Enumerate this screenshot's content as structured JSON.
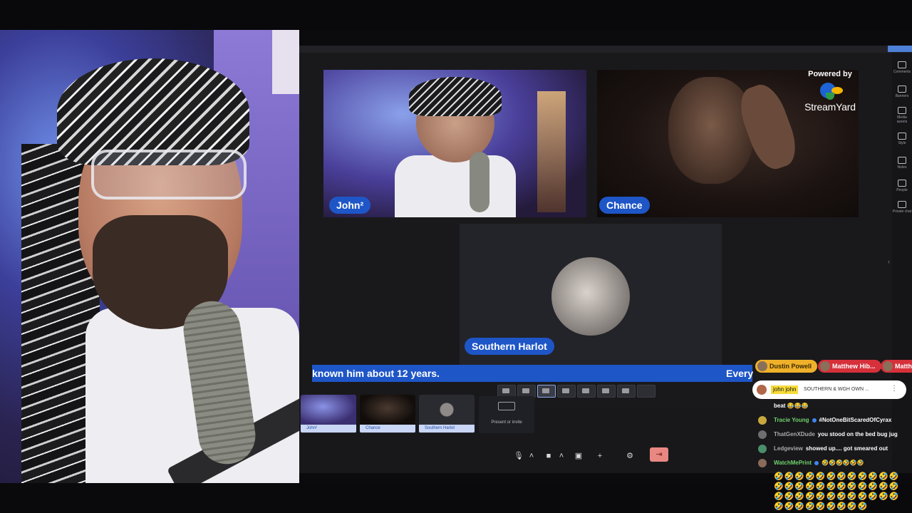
{
  "app_title": "",
  "participants": [
    {
      "name": "John²"
    },
    {
      "name": "Chance"
    },
    {
      "name": "Southern Harlot"
    }
  ],
  "branding": {
    "powered_by": "Powered by",
    "logo": "StreamYard"
  },
  "ticker": {
    "text": "known him about 12 years.",
    "next": "Every"
  },
  "backstage": {
    "thumbs": [
      "John²",
      "Chance",
      "Southern Harlot"
    ],
    "present_label": "Present or invite"
  },
  "dock": {
    "items": [
      {
        "label": "Comments",
        "icon": "comment-icon"
      },
      {
        "label": "Banners",
        "icon": "banner-icon"
      },
      {
        "label": "Media assets",
        "icon": "media-icon"
      },
      {
        "label": "Style",
        "icon": "palette-icon"
      },
      {
        "label": "Notes",
        "icon": "notes-icon"
      },
      {
        "label": "People",
        "icon": "people-icon"
      },
      {
        "label": "Private chat",
        "icon": "private-chat-icon"
      }
    ]
  },
  "chat": {
    "tags": [
      {
        "name": "Dustin Powell",
        "color": "#f0b12a"
      },
      {
        "name": "Matthew Hib...",
        "color": "#d6303a"
      },
      {
        "name": "Matthe",
        "color": "#d6303a"
      }
    ],
    "pinned": {
      "author": "john john",
      "text": "SOUTHERN & WGH OWN ..."
    },
    "messages": [
      {
        "author": "",
        "text": "beat 😂😂😂"
      },
      {
        "author": "Tracie Young",
        "text": "#NotOneBitScaredOfCyrax"
      },
      {
        "author": "ThatGenXDude",
        "text": "you stood on the bed bug jug"
      },
      {
        "author": "Ledgeview",
        "text": "showed up.... got smeared out"
      },
      {
        "author": "WatchMePrint",
        "text": "🤣🤣🤣🤣🤣🤣"
      }
    ],
    "emoji_spam": "🤣🤣🤣🤣🤣🤣🤣🤣🤣🤣🤣🤣🤣🤣🤣🤣🤣🤣🤣🤣🤣🤣🤣🤣🤣🤣🤣🤣🤣🤣🤣🤣🤣🤣🤣🤣🤣🤣🤣🤣🤣🤣🤣🤣🤣"
  }
}
